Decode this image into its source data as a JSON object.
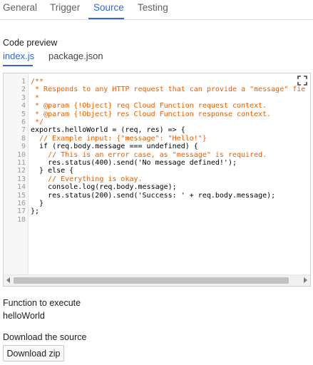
{
  "tabs": [
    {
      "label": "General"
    },
    {
      "label": "Trigger"
    },
    {
      "label": "Source",
      "active": true
    },
    {
      "label": "Testing"
    }
  ],
  "code_preview": {
    "label": "Code preview",
    "files": [
      {
        "label": "index.js",
        "active": true
      },
      {
        "label": "package.json"
      }
    ],
    "line_numbers": [
      "1",
      "2",
      "3",
      "4",
      "5",
      "6",
      "7",
      "8",
      "9",
      "10",
      "11",
      "12",
      "13",
      "14",
      "15",
      "16",
      "17",
      "18"
    ],
    "lines": [
      "/**",
      " * Responds to any HTTP request that can provide a \"message\" fie",
      " *",
      " * @param {!Object} req Cloud Function request context.",
      " * @param {!Object} res Cloud Function response context.",
      " */",
      "exports.helloWorld = (req, res) => {",
      "  // Example input: {\"message\": \"Hello!\"}",
      "  if (req.body.message === undefined) {",
      "    // This is an error case, as \"message\" is required.",
      "    res.status(400).send('No message defined!');",
      "  } else {",
      "    // Everything is okay.",
      "    console.log(req.body.message);",
      "    res.status(200).send('Success: ' + req.body.message);",
      "  }",
      "};",
      ""
    ]
  },
  "function_to_execute": {
    "label": "Function to execute",
    "value": "helloWorld"
  },
  "download": {
    "label": "Download the source",
    "button_label": "Download zip"
  },
  "colors": {
    "accent": "#3367d6",
    "comment": "#e45f00",
    "keyword": "#9c27b0",
    "string": "#a31515",
    "number": "#1a1aa6"
  }
}
